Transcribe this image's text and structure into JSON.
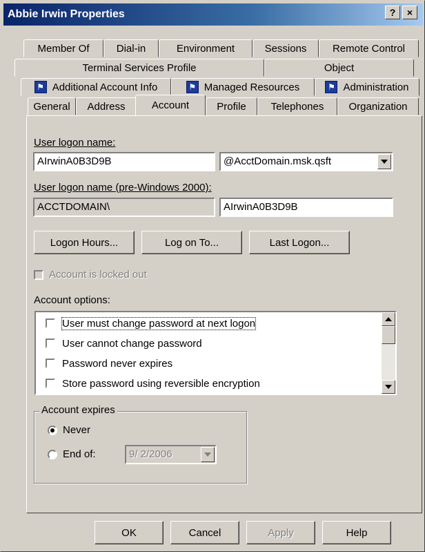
{
  "window": {
    "title": "Abbie Irwin Properties",
    "help_btn": "?",
    "close_btn": "×"
  },
  "tabs": {
    "row1": [
      "Member Of",
      "Dial-in",
      "Environment",
      "Sessions",
      "Remote Control"
    ],
    "row2": [
      "Terminal Services Profile",
      "Object"
    ],
    "row3": [
      "Additional Account Info",
      "Managed Resources",
      "Administration"
    ],
    "row4": [
      "General",
      "Address",
      "Account",
      "Profile",
      "Telephones",
      "Organization"
    ],
    "active": "Account"
  },
  "account": {
    "logon_name_label": "User logon name:",
    "logon_name_value": "AIrwinA0B3D9B",
    "domain_value": "@AcctDomain.msk.qsft",
    "pre2000_label": "User logon name (pre-Windows 2000):",
    "pre2000_domain": "ACCTDOMAIN\\",
    "pre2000_name": "AIrwinA0B3D9B",
    "btn_logon_hours": "Logon Hours...",
    "btn_log_on_to": "Log on To...",
    "btn_last_logon": "Last Logon...",
    "locked_out_label": "Account is locked out",
    "options_label": "Account options:",
    "options": [
      "User must change password at next logon",
      "User cannot change password",
      "Password never expires",
      "Store password using reversible encryption"
    ],
    "expires_label": "Account expires",
    "never_label": "Never",
    "end_of_label": "End of:",
    "end_of_date": "9/  2/2006"
  },
  "footer": {
    "ok": "OK",
    "cancel": "Cancel",
    "apply": "Apply",
    "help": "Help"
  }
}
